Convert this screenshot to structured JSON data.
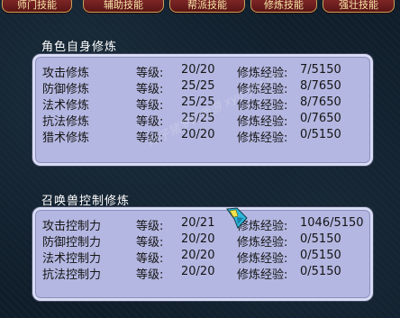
{
  "tabs": [
    "师门技能",
    "辅助技能",
    "帮派技能",
    "修炼技能",
    "强壮技能"
  ],
  "self_cultivation": {
    "title": "角色自身修炼",
    "rows": [
      {
        "name": "攻击修炼",
        "level_label": "等级:",
        "level": "20/20",
        "exp_label": "修炼经验:",
        "exp": "7/5150"
      },
      {
        "name": "防御修炼",
        "level_label": "等级:",
        "level": "25/25",
        "exp_label": "修炼经验:",
        "exp": "8/7650"
      },
      {
        "name": "法术修炼",
        "level_label": "等级:",
        "level": "25/25",
        "exp_label": "修炼经验:",
        "exp": "8/7650"
      },
      {
        "name": "抗法修炼",
        "level_label": "等级:",
        "level": "25/25",
        "exp_label": "修炼经验:",
        "exp": "0/7650"
      },
      {
        "name": "猎术修炼",
        "level_label": "等级:",
        "level": "20/20",
        "exp_label": "修炼经验:",
        "exp": "0/5150"
      }
    ]
  },
  "pet_control": {
    "title": "召唤兽控制修炼",
    "rows": [
      {
        "name": "攻击控制力",
        "level_label": "等级:",
        "level": "20/21",
        "exp_label": "修炼经验:",
        "exp": "1046/5150"
      },
      {
        "name": "防御控制力",
        "level_label": "等级:",
        "level": "20/20",
        "exp_label": "修炼经验:",
        "exp": "0/5150"
      },
      {
        "name": "法术控制力",
        "level_label": "等级:",
        "level": "20/20",
        "exp_label": "修炼经验:",
        "exp": "0/5150"
      },
      {
        "name": "抗法控制力",
        "level_label": "等级:",
        "level": "20/20",
        "exp_label": "修炼经验:",
        "exp": "0/5150"
      }
    ]
  },
  "watermark": "叶子猪梦幻西游 xyq.yzz.cn"
}
